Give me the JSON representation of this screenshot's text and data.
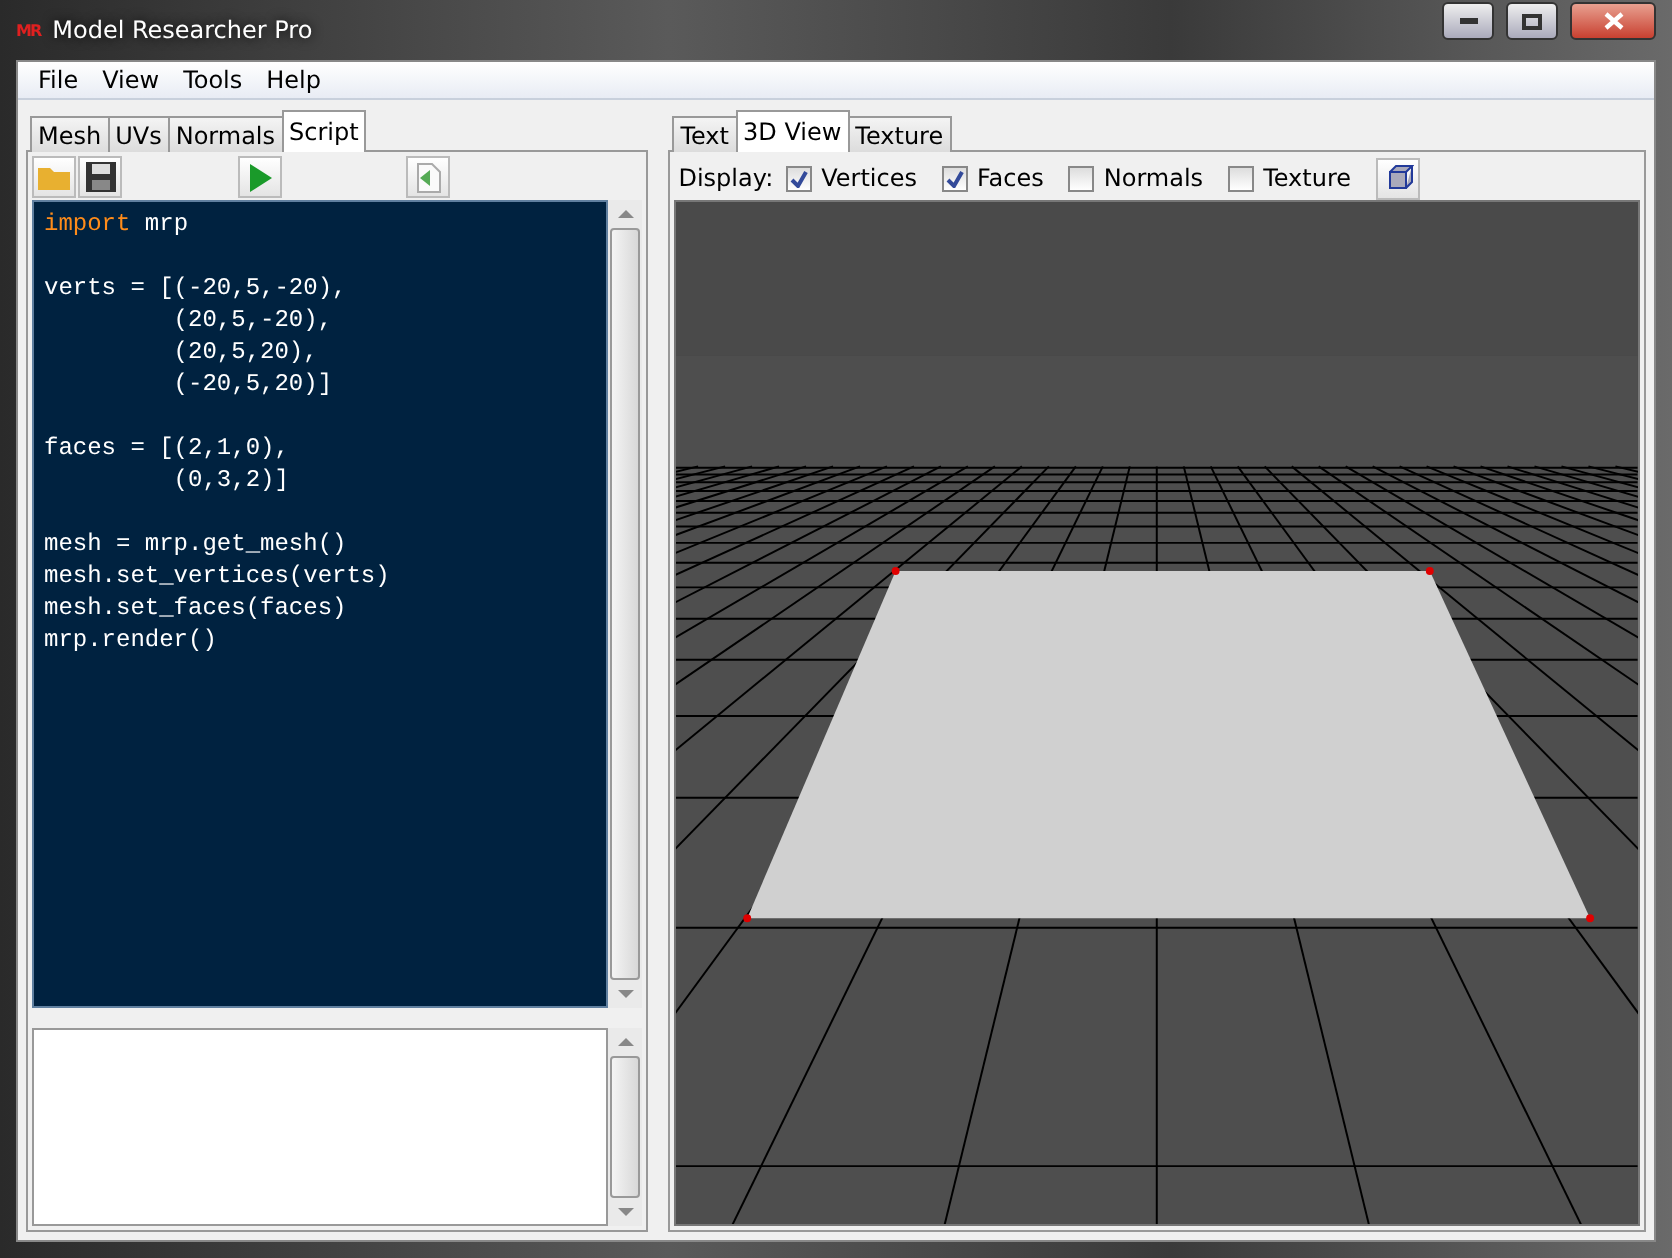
{
  "window": {
    "title": "Model Researcher Pro",
    "logo": "MR"
  },
  "menu": [
    "File",
    "View",
    "Tools",
    "Help"
  ],
  "left_tabs": [
    {
      "label": "Mesh",
      "selected": false
    },
    {
      "label": "UVs",
      "selected": false
    },
    {
      "label": "Normals",
      "selected": false
    },
    {
      "label": "Script",
      "selected": true
    }
  ],
  "script": {
    "blocks": [
      [
        [
          {
            "kind": "keyword",
            "text": "import"
          },
          {
            "kind": "plain",
            "text": " mrp"
          }
        ]
      ],
      [
        [
          {
            "kind": "plain",
            "text": "verts = [(-20,5,-20),"
          }
        ],
        [
          {
            "kind": "plain",
            "text": "         (20,5,-20),"
          }
        ],
        [
          {
            "kind": "plain",
            "text": "         (20,5,20),"
          }
        ],
        [
          {
            "kind": "plain",
            "text": "         (-20,5,20)]"
          }
        ]
      ],
      [
        [
          {
            "kind": "plain",
            "text": "faces = [(2,1,0),"
          }
        ],
        [
          {
            "kind": "plain",
            "text": "         (0,3,2)]"
          }
        ]
      ],
      [
        [
          {
            "kind": "plain",
            "text": "mesh = mrp.get_mesh()"
          }
        ],
        [
          {
            "kind": "plain",
            "text": "mesh.set_vertices(verts)"
          }
        ],
        [
          {
            "kind": "plain",
            "text": "mesh.set_faces(faces)"
          }
        ],
        [
          {
            "kind": "plain",
            "text": "mrp.render()"
          }
        ]
      ]
    ]
  },
  "right_tabs": [
    {
      "label": "Text",
      "selected": false
    },
    {
      "label": "3D View",
      "selected": true
    },
    {
      "label": "Texture",
      "selected": false
    }
  ],
  "display": {
    "label": "Display:",
    "options": [
      {
        "label": "Vertices",
        "checked": true
      },
      {
        "label": "Faces",
        "checked": true
      },
      {
        "label": "Normals",
        "checked": false
      },
      {
        "label": "Texture",
        "checked": false
      }
    ]
  }
}
